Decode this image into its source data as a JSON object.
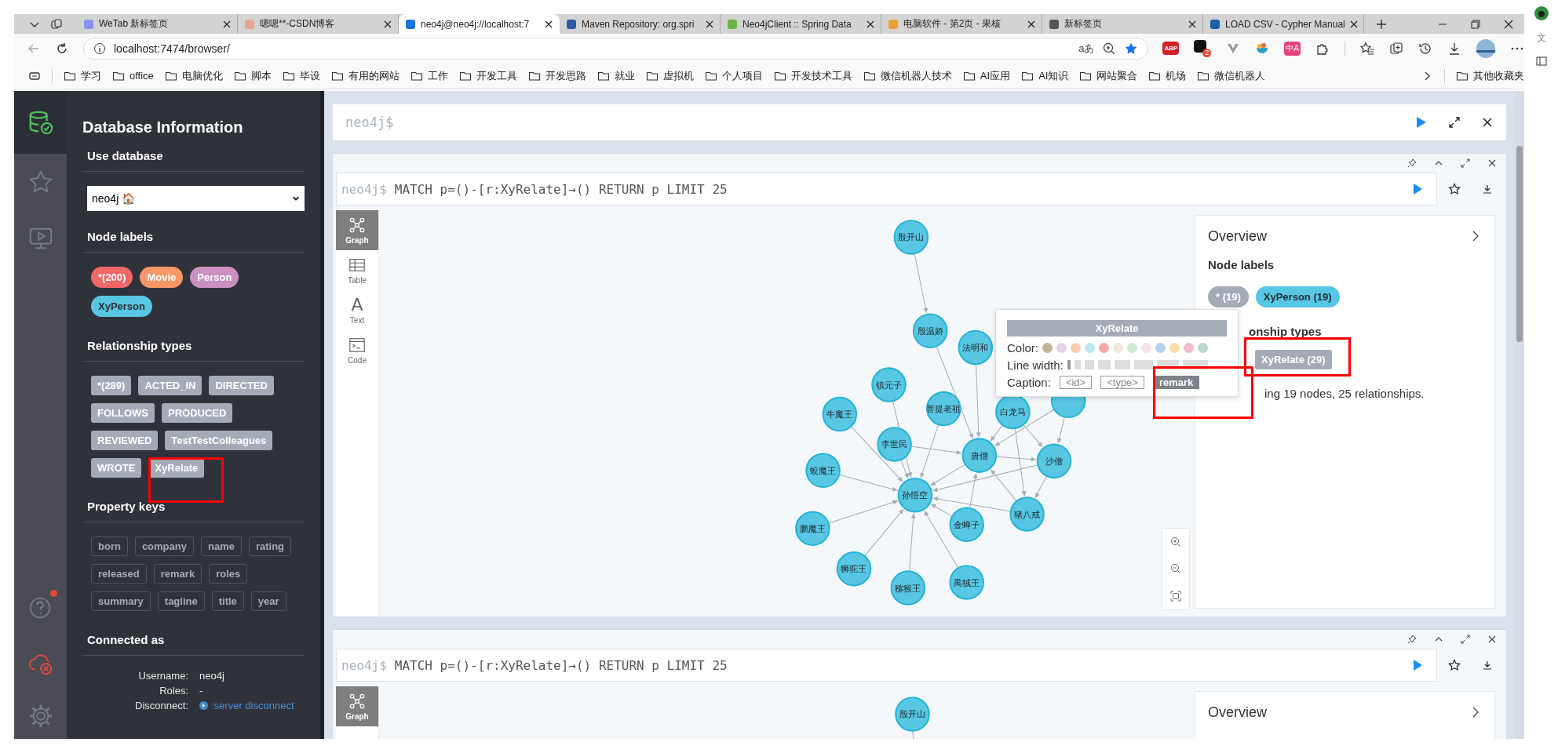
{
  "browser": {
    "tabs": [
      {
        "title": "WeTab 新标签页",
        "selected": false
      },
      {
        "title": "嗯嗯**-CSDN博客",
        "selected": false
      },
      {
        "title": "neo4j@neo4j://localhost:7",
        "selected": true
      },
      {
        "title": "Maven Repository: org.spri",
        "selected": false
      },
      {
        "title": "Neo4jClient :: Spring Data",
        "selected": false
      },
      {
        "title": "电脑软件 - 第2页 - 果核",
        "selected": false
      },
      {
        "title": "新标签页",
        "selected": false
      },
      {
        "title": "LOAD CSV - Cypher Manual",
        "selected": false
      }
    ],
    "address": "localhost:7474/browser/",
    "read_aloud_glyph": "aあ",
    "abp_label": "ABP",
    "extension_badge": "2",
    "translate_glyph": "中A",
    "bookmarks": [
      "学习",
      "office",
      "电脑优化",
      "脚本",
      "毕设",
      "有用的网站",
      "工作",
      "开发工具",
      "开发思路",
      "就业",
      "虚拟机",
      "个人项目",
      "开发技术工具",
      "微信机器人技术",
      "AI应用",
      "AI知识",
      "网站聚合",
      "机场",
      "微信机器人"
    ],
    "other_bookmarks": "其他收藏夹",
    "edge_strip_text": "文"
  },
  "sidebar": {
    "rail": [
      {
        "kind": "database",
        "selected": true
      },
      {
        "kind": "favorites",
        "selected": false
      },
      {
        "kind": "guides",
        "selected": false
      }
    ],
    "help_notification": true,
    "title": "Database Information",
    "use_database_heading": "Use database",
    "database": "neo4j 🏠",
    "node_labels_heading": "Node labels",
    "node_labels": [
      {
        "name": "*(200)",
        "color": "#f16667",
        "dark_text": false
      },
      {
        "name": "Movie",
        "color": "#f79767",
        "dark_text": false
      },
      {
        "name": "Person",
        "color": "#c990c0",
        "dark_text": false
      },
      {
        "name": "XyPerson",
        "color": "#57c7e3",
        "dark_text": true
      }
    ],
    "relationship_types_heading": "Relationship types",
    "relationship_types": [
      "*(289)",
      "ACTED_IN",
      "DIRECTED",
      "FOLLOWS",
      "PRODUCED",
      "REVIEWED",
      "TestTestColleagues",
      "WROTE",
      "XyRelate"
    ],
    "property_keys_heading": "Property keys",
    "property_keys": [
      "born",
      "company",
      "name",
      "rating",
      "released",
      "remark",
      "roles",
      "summary",
      "tagline",
      "title",
      "year"
    ],
    "connected_as_heading": "Connected as",
    "connection": [
      {
        "label": "Username:",
        "value": "neo4j",
        "kind": "text"
      },
      {
        "label": "Roles:",
        "value": "-",
        "kind": "text"
      },
      {
        "label": "Disconnect:",
        "value": ":server disconnect",
        "kind": "link"
      }
    ]
  },
  "editor": {
    "prompt": "neo4j$"
  },
  "frames": [
    {
      "prompt": "neo4j$",
      "query": "MATCH p=()-[r:XyRelate]→() RETURN p LIMIT 25",
      "views": [
        {
          "label": "Graph",
          "kind": "graph",
          "selected": true
        },
        {
          "label": "Table",
          "kind": "table",
          "selected": false
        },
        {
          "label": "Text",
          "kind": "text",
          "glyph": "A",
          "selected": false
        },
        {
          "label": "Code",
          "kind": "code",
          "selected": false
        }
      ],
      "graph_nodes": [
        "殷开山",
        "殷温娇",
        "法明和",
        "镇元子",
        "牛魔王",
        "菩提老祖",
        "白龙马",
        "蛟魔王",
        "李世民",
        "唐僧",
        "沙僧",
        "孙悟空",
        "鹏魔王",
        "金蝉子",
        "猪八戒",
        "狮驼王",
        "猕猴王",
        "禺狨王"
      ],
      "overview": {
        "title": "Overview",
        "node_labels_heading": "Node labels",
        "node_labels": [
          {
            "name": "* (19)",
            "color": "#a5abb6",
            "dark_text": false
          },
          {
            "name": "XyPerson (19)",
            "color": "#57c7e3",
            "dark_text": true
          }
        ],
        "relationship_types_heading": "onship types",
        "relationship_types": [
          "XyRelate (29)"
        ],
        "summary": "ing 19 nodes, 25 relationships."
      }
    },
    {
      "prompt": "neo4j$",
      "query": "MATCH p=()-[r:XyRelate]→() RETURN p LIMIT 25",
      "views": [
        {
          "label": "Graph",
          "kind": "graph",
          "selected": true
        }
      ],
      "graph_nodes": [
        "殷开山"
      ],
      "overview": {
        "title": "Overview"
      }
    }
  ],
  "style_popup": {
    "title": "XyRelate",
    "color_label": "Color:",
    "colors": [
      {
        "color": "#c0b595"
      },
      {
        "color": "#e8d3ea"
      },
      {
        "color": "#fbcbb4"
      },
      {
        "color": "#bde8f3"
      },
      {
        "color": "#f6aaa8"
      },
      {
        "color": "#efe8df"
      },
      {
        "color": "#cfe8d3"
      },
      {
        "color": "#f8e0e8"
      },
      {
        "color": "#b8d0f0"
      },
      {
        "color": "#fcdea6"
      },
      {
        "color": "#f1bccc"
      },
      {
        "color": "#bdd8ca"
      }
    ],
    "line_width_label": "Line width:",
    "line_widths": [
      {
        "selected": true
      },
      {
        "selected": false
      },
      {
        "selected": false
      },
      {
        "selected": false
      },
      {
        "selected": false
      },
      {
        "selected": false
      },
      {
        "selected": false
      },
      {
        "selected": false
      }
    ],
    "caption_label": "Caption:",
    "captions": [
      {
        "label": "<id>",
        "selected": false
      },
      {
        "label": "<type>",
        "selected": false
      },
      {
        "label": "remark",
        "selected": true
      }
    ]
  }
}
